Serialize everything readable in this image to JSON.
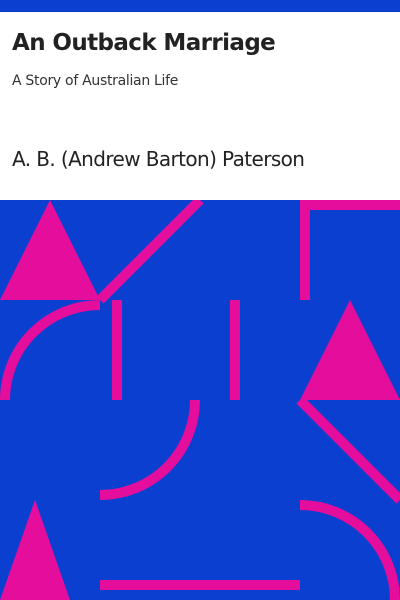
{
  "book": {
    "title": "An Outback Marriage",
    "subtitle": "A Story of Australian Life",
    "author": "A. B. (Andrew Barton) Paterson"
  },
  "colors": {
    "background": "#0b3fd0",
    "shape": "#e50d9c",
    "header_bg": "#ffffff",
    "text": "#222222"
  },
  "cover_art": {
    "pattern": "geometric-shapes"
  }
}
